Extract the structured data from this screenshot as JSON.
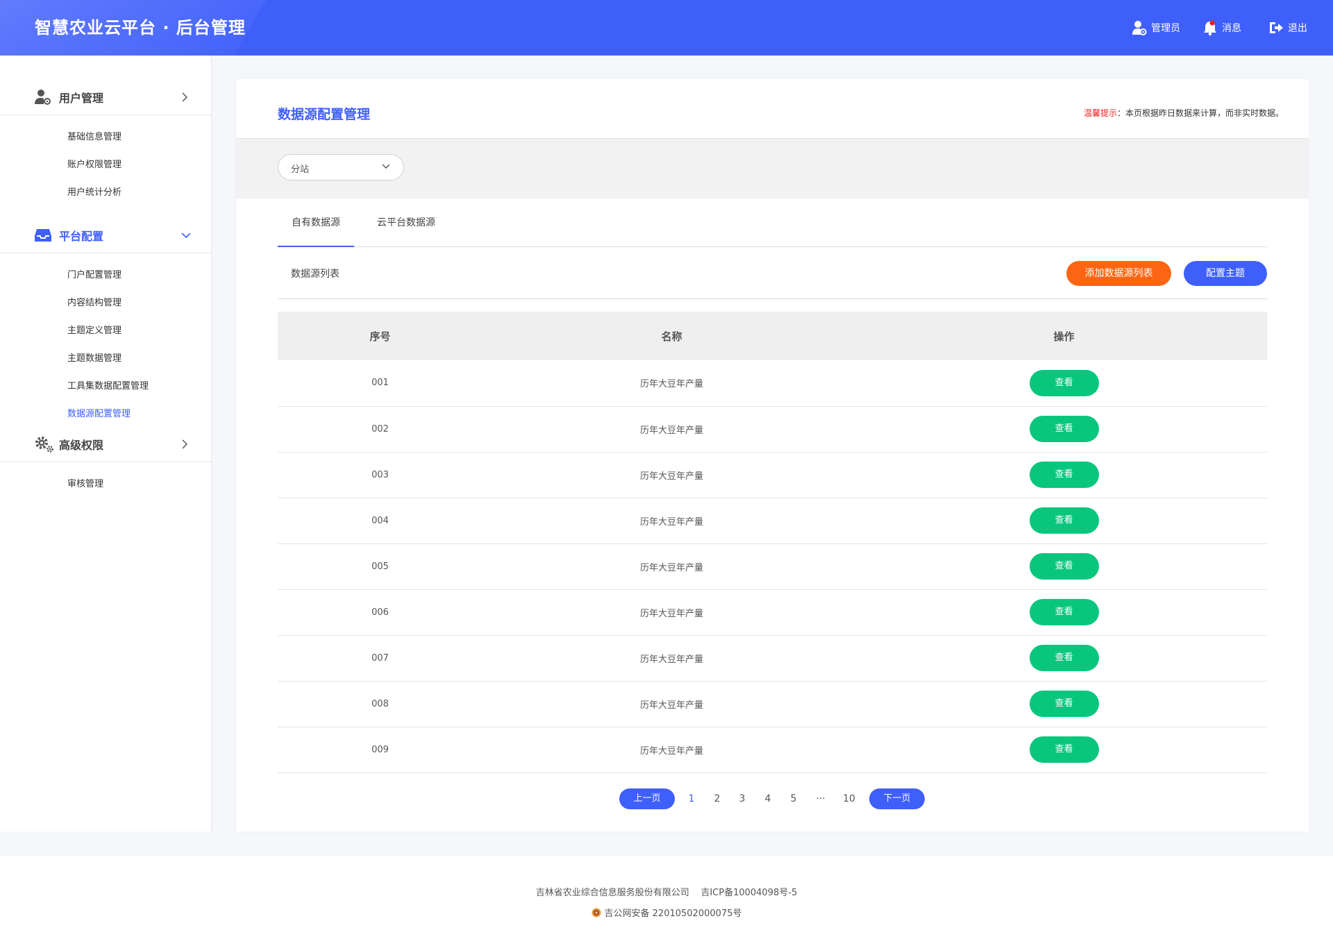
{
  "header": {
    "brand": "智慧农业云平台 · 后台管理",
    "admin_label": "管理员",
    "message_label": "消息",
    "logout_label": "退出",
    "color": "#3f5ffb"
  },
  "sidebar": {
    "sections": [
      {
        "title": "用户管理",
        "icon": "user-gear-icon",
        "items": [
          "基础信息管理",
          "账户权限管理",
          "用户统计分析"
        ]
      },
      {
        "title": "平台配置",
        "icon": "inbox-icon",
        "items": [
          "门户配置管理",
          "内容结构管理",
          "主题定义管理",
          "主题数据管理",
          "工具集数据配置管理",
          "数据源配置管理"
        ]
      },
      {
        "title": "高级权限",
        "icon": "gears-icon",
        "items": [
          "审核管理"
        ]
      }
    ],
    "active_section": "平台配置",
    "active_item": "数据源配置管理"
  },
  "main": {
    "title": "数据源配置管理",
    "tip_label": "温馨提示",
    "tip_text": "：本页根据昨日数据来计算，而非实时数据。",
    "filter": {
      "value": "分站"
    },
    "tabs": [
      "自有数据源",
      "云平台数据源"
    ],
    "active_tab": "自有数据源",
    "list_title": "数据源列表",
    "add_button": "添加数据源列表",
    "config_button": "配置主题",
    "table": {
      "headers": [
        "序号",
        "名称",
        "操作"
      ],
      "rows": [
        {
          "id": "001",
          "name": "历年大豆年产量",
          "action": "查看"
        },
        {
          "id": "002",
          "name": "历年大豆年产量",
          "action": "查看"
        },
        {
          "id": "003",
          "name": "历年大豆年产量",
          "action": "查看"
        },
        {
          "id": "004",
          "name": "历年大豆年产量",
          "action": "查看"
        },
        {
          "id": "005",
          "name": "历年大豆年产量",
          "action": "查看"
        },
        {
          "id": "006",
          "name": "历年大豆年产量",
          "action": "查看"
        },
        {
          "id": "007",
          "name": "历年大豆年产量",
          "action": "查看"
        },
        {
          "id": "008",
          "name": "历年大豆年产量",
          "action": "查看"
        },
        {
          "id": "009",
          "name": "历年大豆年产量",
          "action": "查看"
        }
      ]
    },
    "pagination": {
      "prev": "上一页",
      "next": "下一页",
      "pages": [
        "1",
        "2",
        "3",
        "4",
        "5",
        "···",
        "10"
      ],
      "current": "1"
    }
  },
  "footer": {
    "company": "吉林省农业综合信息服务股份有限公司",
    "icp": "吉ICP备10004098号-5",
    "police": "吉公网安备 22010502000075号"
  }
}
